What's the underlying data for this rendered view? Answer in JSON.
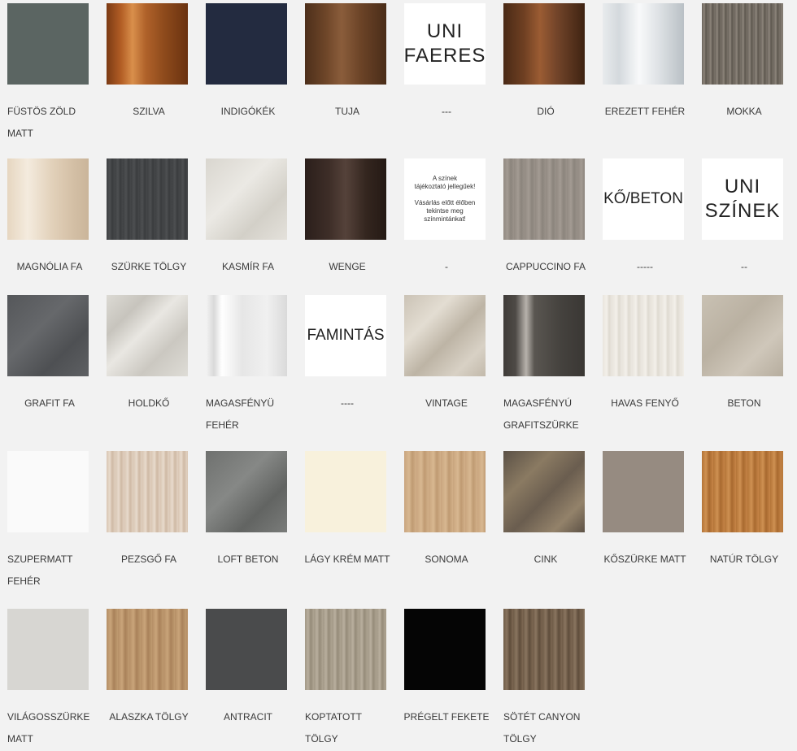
{
  "swatches": [
    {
      "label": "FÜSTÖS ZÖLD MATT",
      "bg": "#5b6562"
    },
    {
      "label": "SZILVA",
      "bg": "linear-gradient(90deg,#7b3a14 0%,#b35e25 18%,#d98f4b 32%,#b0622a 48%,#8f4b1c 70%,#6a3210 100%)"
    },
    {
      "label": "INDIGÓKÉK",
      "bg": "#232b40"
    },
    {
      "label": "TUJA",
      "bg": "linear-gradient(90deg,#4d2f1b 0%,#6d4528 25%,#8a5d3b 45%,#6a4226 70%,#4a2d19 100%)"
    },
    {
      "label": "---",
      "bg": "#ffffff",
      "text": "UNI\nFAERES",
      "textStyle": "big"
    },
    {
      "label": "DIÓ",
      "bg": "linear-gradient(90deg,#4a2a16 0%,#6e3f22 25%,#9b5c33 45%,#74452a 65%,#3e2312 100%)"
    },
    {
      "label": "EREZETT FEHÉR",
      "bg": "linear-gradient(90deg,#e8ebed 0%,#d4d9dd 20%,#f8f9fa 45%,#dde1e4 70%,#b9c0c5 100%)"
    },
    {
      "label": "MOKKA",
      "bg": "repeating-linear-gradient(90deg,#6b645c 0px,#8d857b 3px,#5d574f 5px,#7a7369 8px)"
    },
    {
      "label": "MAGNÓLIA FA",
      "bg": "linear-gradient(90deg,#e6d6c0 0%,#f4ebde 25%,#e2d1ba 55%,#d4c0a6 80%,#cab59a 100%)"
    },
    {
      "label": "SZÜRKE TÖLGY",
      "bg": "repeating-linear-gradient(90deg,#3f4143 0px,#4d4f51 4px,#3a3c3e 7px,#46484a 10px)"
    },
    {
      "label": "KASMÍR FA",
      "bg": "linear-gradient(135deg,#d9d6cf 0%,#ebe9e4 40%,#d3d0c8 70%,#e4e1db 100%)"
    },
    {
      "label": "WENGE",
      "bg": "linear-gradient(90deg,#2b1f1b 0%,#3e2e28 30%,#55423a 50%,#34261f 75%,#241914 100%)"
    },
    {
      "label": "-",
      "bg": "#ffffff",
      "text": "A színek\ntájékoztató jellegűek!\n\nVásárlás előtt élőben\ntekintse meg\nszínmintánkat!",
      "textStyle": "note"
    },
    {
      "label": "CAPPUCCINO FA",
      "bg": "repeating-linear-gradient(90deg,#928a82 0px,#a39b93 5px,#8b847c 9px,#9a928a 13px)"
    },
    {
      "label": "-----",
      "bg": "#ffffff",
      "text": "KŐ/BETON",
      "textStyle": "mid"
    },
    {
      "label": "--",
      "bg": "#ffffff",
      "text": "UNI\nSZÍNEK",
      "textStyle": "big"
    },
    {
      "label": "GRAFIT FA",
      "bg": "linear-gradient(135deg,#55575a 0%,#66686b 40%,#4e5053 70%,#5e6063 100%)"
    },
    {
      "label": "HOLDKŐ",
      "bg": "linear-gradient(135deg,#dcdad4 0%,#c7c4bd 25%,#e9e7e2 45%,#cbc8c1 70%,#dedcd6 100%)"
    },
    {
      "label": "MAGASFÉNYÜ FEHÉR",
      "bg": "linear-gradient(90deg,#f4f4f4 0%,#d9d9d9 10%,#ffffff 20%,#e6e6e6 45%,#f0f0f0 75%,#dadada 100%)"
    },
    {
      "label": "----",
      "bg": "#ffffff",
      "text": "FAMINTÁS",
      "textStyle": "mid"
    },
    {
      "label": "VINTAGE",
      "bg": "linear-gradient(135deg,#cbc3b6 0%,#e3ddd2 30%,#bdb4a5 55%,#d8d1c5 80%,#c2b9aa 100%)"
    },
    {
      "label": "MAGASFÉNYÚ GRAFITSZÜRKE",
      "bg": "linear-gradient(90deg,#3f3c39 0%,#4e4a46 15%,#b7b2ac 28%,#5a5651 38%,#45423e 70%,#3a3734 100%)"
    },
    {
      "label": "HAVAS FENYŐ",
      "bg": "repeating-linear-gradient(90deg,#e9e5dd 0px,#f3f0ea 5px,#dfdad1 8px,#ece8e1 12px)"
    },
    {
      "label": "BETON",
      "bg": "linear-gradient(135deg,#c9c1b3 0%,#bab1a2 40%,#cfc7ba 70%,#b6ad9e 100%)"
    },
    {
      "label": "SZUPERMATT FEHÉR",
      "bg": "#fafafa"
    },
    {
      "label": "PEZSGŐ FA",
      "bg": "repeating-linear-gradient(90deg,#d9c6b3 0px,#e8dbcd 4px,#cfb9a4 7px,#e1d1c1 11px)"
    },
    {
      "label": "LOFT BETON",
      "bg": "linear-gradient(135deg,#6f716f 0%,#868886 40%,#626462 70%,#7a7c7a 100%)"
    },
    {
      "label": "LÁGY KRÉM MATT",
      "bg": "#f8f1dc"
    },
    {
      "label": "SONOMA",
      "bg": "repeating-linear-gradient(90deg,#c9a57e 0px,#d8b891 6px,#bf9a72 10px,#d2b089 15px)"
    },
    {
      "label": "CINK",
      "bg": "linear-gradient(135deg,#5b5146 0%,#8a7a62 30%,#6a5d4f 55%,#93826a 80%,#5d5246 100%)"
    },
    {
      "label": "KŐSZÜRKE MATT",
      "bg": "#968b81"
    },
    {
      "label": "NATÚR TÖLGY",
      "bg": "repeating-linear-gradient(90deg,#b37437 0px,#cf9152 5px,#a8692f 9px,#c68547 14px)"
    },
    {
      "label": "VILÁGOSSZÜRKE MATT",
      "bg": "#d7d6d2"
    },
    {
      "label": "ALASZKA TÖLGY",
      "bg": "repeating-linear-gradient(90deg,#b58f66 0px,#c9a47a 5px,#a9825a 9px,#bf9a70 14px)"
    },
    {
      "label": "ANTRACIT",
      "bg": "#4a4b4c"
    },
    {
      "label": "KOPTATOTT TÖLGY",
      "bg": "repeating-linear-gradient(90deg,#a29886 0px,#b9af9e 4px,#958b79 7px,#aea492 11px)"
    },
    {
      "label": "PRÉGELT FEKETE",
      "bg": "#050505"
    },
    {
      "label": "SÖTÉT CANYON TÖLGY",
      "bg": "repeating-linear-gradient(90deg,#6e5b47 0px,#8a7560 4px,#5f4d3b 8px,#7d6853 12px)"
    }
  ]
}
